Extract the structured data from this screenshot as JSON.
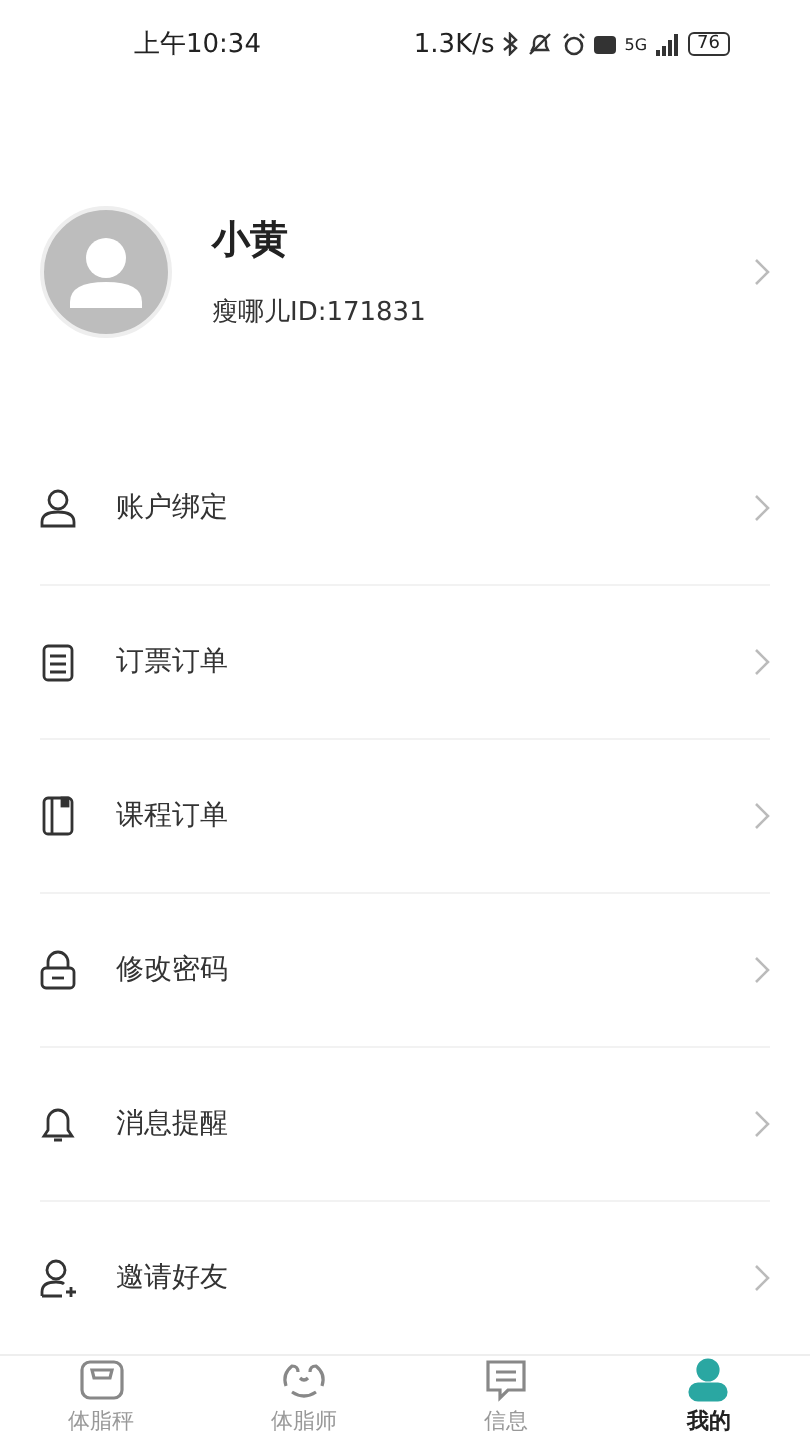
{
  "status_bar": {
    "time": "上午10:34",
    "speed": "1.3K/s",
    "network": "5G",
    "battery": "76"
  },
  "profile": {
    "name": "小黄",
    "id_label": "瘦哪儿ID:171831"
  },
  "menu": [
    {
      "kind": "user",
      "label": "账户绑定"
    },
    {
      "kind": "list",
      "label": "订票订单"
    },
    {
      "kind": "book",
      "label": "课程订单"
    },
    {
      "kind": "lock",
      "label": "修改密码"
    },
    {
      "kind": "bell",
      "label": "消息提醒"
    },
    {
      "kind": "invite",
      "label": "邀请好友"
    }
  ],
  "tab_bar": [
    {
      "kind": "scale",
      "label": "体脂秤",
      "selected": false
    },
    {
      "kind": "coach",
      "label": "体脂师",
      "selected": false
    },
    {
      "kind": "message",
      "label": "信息",
      "selected": false
    },
    {
      "kind": "me",
      "label": "我的",
      "selected": true
    }
  ]
}
